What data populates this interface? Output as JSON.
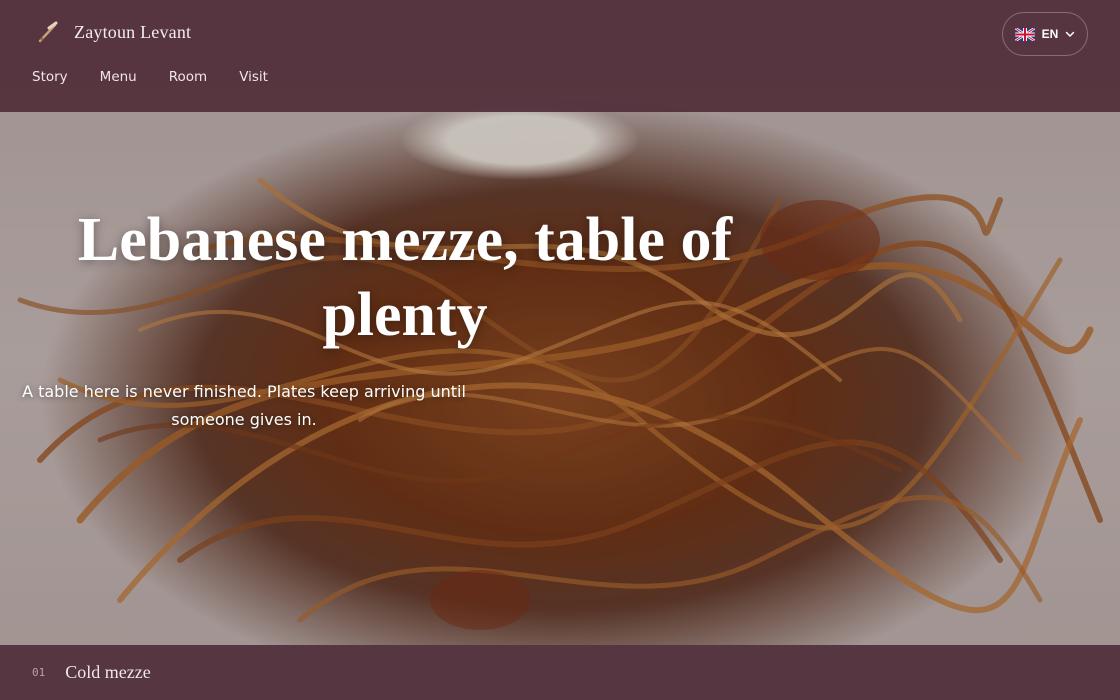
{
  "brand": {
    "name": "Zaytoun Levant",
    "logo_icon": "olive-branch-icon"
  },
  "nav": {
    "items": [
      "Story",
      "Menu",
      "Room",
      "Visit"
    ]
  },
  "language": {
    "code": "EN",
    "flag_icon": "uk-flag-icon",
    "chevron_icon": "chevron-down-icon"
  },
  "hero": {
    "headline_line1": "Lebanese mezze, table of",
    "headline_line2": "plenty",
    "subline_line1": "A table here is never finished. Plates keep arriving until",
    "subline_line2": "someone gives in.",
    "image_subject": "pasta-plate-photo"
  },
  "section": {
    "number": "01",
    "label": "Cold mezze"
  },
  "colors": {
    "header_bg": "#522e3a",
    "strip_bg": "#553641",
    "text_light": "#ffffff"
  }
}
